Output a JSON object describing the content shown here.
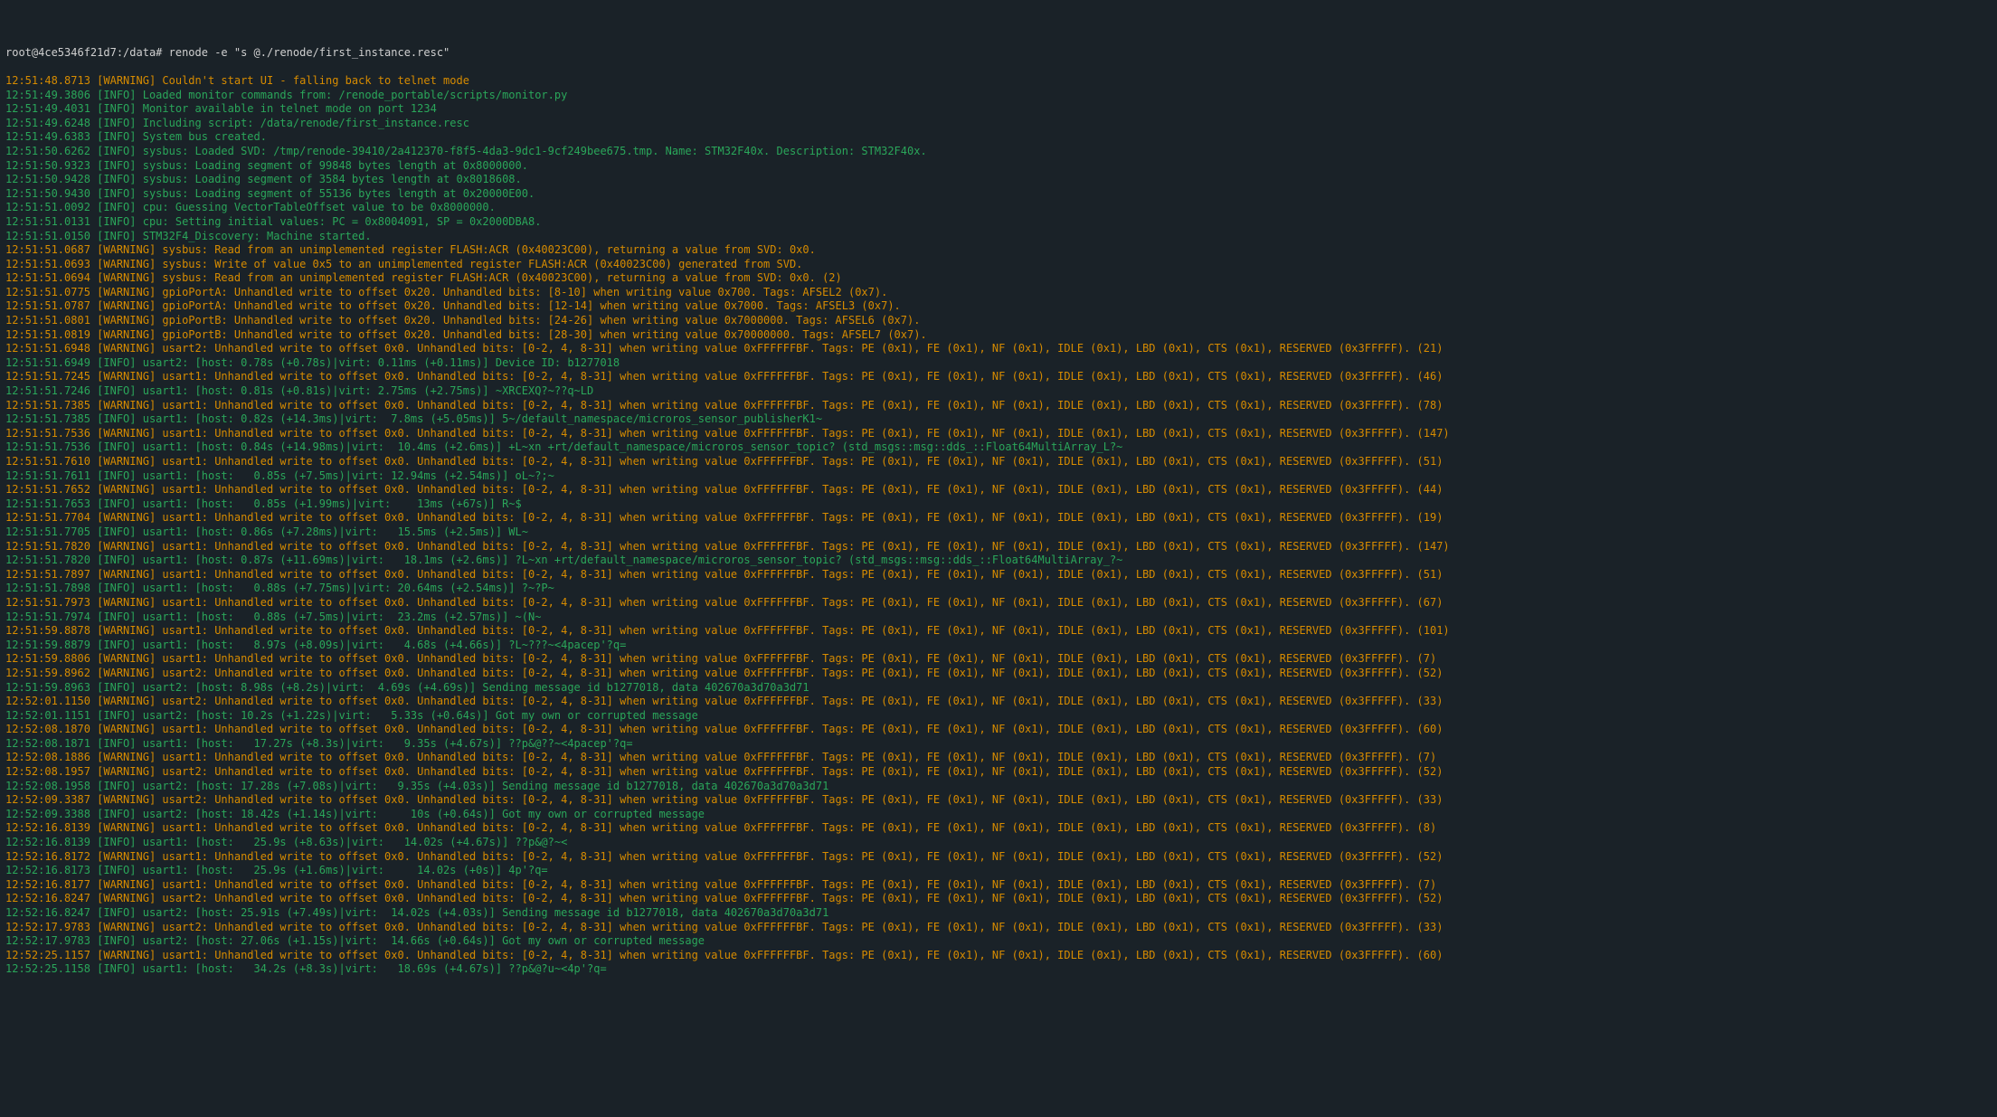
{
  "prompt": "root@4ce5346f21d7:/data# ",
  "command": "renode -e \"s @./renode/first_instance.resc\"",
  "lines": [
    {
      "t": "12:51:48.8713",
      "lvl": "WARNING",
      "msg": "Couldn't start UI - falling back to telnet mode"
    },
    {
      "t": "12:51:49.3806",
      "lvl": "INFO",
      "msg": "Loaded monitor commands from: /renode_portable/scripts/monitor.py"
    },
    {
      "t": "12:51:49.4031",
      "lvl": "INFO",
      "msg": "Monitor available in telnet mode on port 1234"
    },
    {
      "t": "12:51:49.6248",
      "lvl": "INFO",
      "msg": "Including script: /data/renode/first_instance.resc"
    },
    {
      "t": "12:51:49.6383",
      "lvl": "INFO",
      "msg": "System bus created."
    },
    {
      "t": "12:51:50.6262",
      "lvl": "INFO",
      "msg": "sysbus: Loaded SVD: /tmp/renode-39410/2a412370-f8f5-4da3-9dc1-9cf249bee675.tmp. Name: STM32F40x. Description: STM32F40x."
    },
    {
      "t": "12:51:50.9323",
      "lvl": "INFO",
      "msg": "sysbus: Loading segment of 99848 bytes length at 0x8000000."
    },
    {
      "t": "12:51:50.9428",
      "lvl": "INFO",
      "msg": "sysbus: Loading segment of 3584 bytes length at 0x8018608."
    },
    {
      "t": "12:51:50.9430",
      "lvl": "INFO",
      "msg": "sysbus: Loading segment of 55136 bytes length at 0x20000E00."
    },
    {
      "t": "12:51:51.0092",
      "lvl": "INFO",
      "msg": "cpu: Guessing VectorTableOffset value to be 0x8000000."
    },
    {
      "t": "12:51:51.0131",
      "lvl": "INFO",
      "msg": "cpu: Setting initial values: PC = 0x8004091, SP = 0x2000DBA8."
    },
    {
      "t": "12:51:51.0150",
      "lvl": "INFO",
      "msg": "STM32F4_Discovery: Machine started."
    },
    {
      "t": "12:51:51.0687",
      "lvl": "WARNING",
      "msg": "sysbus: Read from an unimplemented register FLASH:ACR (0x40023C00), returning a value from SVD: 0x0."
    },
    {
      "t": "12:51:51.0693",
      "lvl": "WARNING",
      "msg": "sysbus: Write of value 0x5 to an unimplemented register FLASH:ACR (0x40023C00) generated from SVD."
    },
    {
      "t": "12:51:51.0694",
      "lvl": "WARNING",
      "msg": "sysbus: Read from an unimplemented register FLASH:ACR (0x40023C00), returning a value from SVD: 0x0. (2)"
    },
    {
      "t": "12:51:51.0775",
      "lvl": "WARNING",
      "msg": "gpioPortA: Unhandled write to offset 0x20. Unhandled bits: [8-10] when writing value 0x700. Tags: AFSEL2 (0x7)."
    },
    {
      "t": "12:51:51.0787",
      "lvl": "WARNING",
      "msg": "gpioPortA: Unhandled write to offset 0x20. Unhandled bits: [12-14] when writing value 0x7000. Tags: AFSEL3 (0x7)."
    },
    {
      "t": "12:51:51.0801",
      "lvl": "WARNING",
      "msg": "gpioPortB: Unhandled write to offset 0x20. Unhandled bits: [24-26] when writing value 0x7000000. Tags: AFSEL6 (0x7)."
    },
    {
      "t": "12:51:51.0819",
      "lvl": "WARNING",
      "msg": "gpioPortB: Unhandled write to offset 0x20. Unhandled bits: [28-30] when writing value 0x70000000. Tags: AFSEL7 (0x7)."
    },
    {
      "t": "12:51:51.6948",
      "lvl": "WARNING",
      "msg": "usart2: Unhandled write to offset 0x0. Unhandled bits: [0-2, 4, 8-31] when writing value 0xFFFFFFBF. Tags: PE (0x1), FE (0x1), NF (0x1), IDLE (0x1), LBD (0x1), CTS (0x1), RESERVED (0x3FFFFF). (21)"
    },
    {
      "t": "12:51:51.6949",
      "lvl": "INFO",
      "msg": "usart2: [host: 0.78s (+0.78s)|virt: 0.11ms (+0.11ms)] Device ID: b1277018"
    },
    {
      "t": "12:51:51.7245",
      "lvl": "WARNING",
      "msg": "usart1: Unhandled write to offset 0x0. Unhandled bits: [0-2, 4, 8-31] when writing value 0xFFFFFFBF. Tags: PE (0x1), FE (0x1), NF (0x1), IDLE (0x1), LBD (0x1), CTS (0x1), RESERVED (0x3FFFFF). (46)"
    },
    {
      "t": "12:51:51.7246",
      "lvl": "INFO",
      "msg": "usart1: [host: 0.81s (+0.81s)|virt: 2.75ms (+2.75ms)] ~XRCEXQ?~??q~LD"
    },
    {
      "t": "12:51:51.7385",
      "lvl": "WARNING",
      "msg": "usart1: Unhandled write to offset 0x0. Unhandled bits: [0-2, 4, 8-31] when writing value 0xFFFFFFBF. Tags: PE (0x1), FE (0x1), NF (0x1), IDLE (0x1), LBD (0x1), CTS (0x1), RESERVED (0x3FFFFF). (78)"
    },
    {
      "t": "12:51:51.7385",
      "lvl": "INFO",
      "msg": "usart1: [host: 0.82s (+14.3ms)|virt:  7.8ms (+5.05ms)] 5~/default_namespace/microros_sensor_publisherK1~"
    },
    {
      "t": "12:51:51.7536",
      "lvl": "WARNING",
      "msg": "usart1: Unhandled write to offset 0x0. Unhandled bits: [0-2, 4, 8-31] when writing value 0xFFFFFFBF. Tags: PE (0x1), FE (0x1), NF (0x1), IDLE (0x1), LBD (0x1), CTS (0x1), RESERVED (0x3FFFFF). (147)"
    },
    {
      "t": "12:51:51.7536",
      "lvl": "INFO",
      "msg": "usart1: [host: 0.84s (+14.98ms)|virt:  10.4ms (+2.6ms)] +L~xn +rt/default_namespace/microros_sensor_topic? (std_msgs::msg::dds_::Float64MultiArray_L?~"
    },
    {
      "t": "12:51:51.7610",
      "lvl": "WARNING",
      "msg": "usart1: Unhandled write to offset 0x0. Unhandled bits: [0-2, 4, 8-31] when writing value 0xFFFFFFBF. Tags: PE (0x1), FE (0x1), NF (0x1), IDLE (0x1), LBD (0x1), CTS (0x1), RESERVED (0x3FFFFF). (51)"
    },
    {
      "t": "12:51:51.7611",
      "lvl": "INFO",
      "msg": "usart1: [host:   0.85s (+7.5ms)|virt: 12.94ms (+2.54ms)] oL~?;~"
    },
    {
      "t": "12:51:51.7652",
      "lvl": "WARNING",
      "msg": "usart1: Unhandled write to offset 0x0. Unhandled bits: [0-2, 4, 8-31] when writing value 0xFFFFFFBF. Tags: PE (0x1), FE (0x1), NF (0x1), IDLE (0x1), LBD (0x1), CTS (0x1), RESERVED (0x3FFFFF). (44)"
    },
    {
      "t": "12:51:51.7653",
      "lvl": "INFO",
      "msg": "usart1: [host:   0.85s (+1.99ms)|virt:    13ms (+67s)] R~$"
    },
    {
      "t": "12:51:51.7704",
      "lvl": "WARNING",
      "msg": "usart1: Unhandled write to offset 0x0. Unhandled bits: [0-2, 4, 8-31] when writing value 0xFFFFFFBF. Tags: PE (0x1), FE (0x1), NF (0x1), IDLE (0x1), LBD (0x1), CTS (0x1), RESERVED (0x3FFFFF). (19)"
    },
    {
      "t": "12:51:51.7705",
      "lvl": "INFO",
      "msg": "usart1: [host: 0.86s (+7.28ms)|virt:   15.5ms (+2.5ms)] WL~"
    },
    {
      "t": "12:51:51.7820",
      "lvl": "WARNING",
      "msg": "usart1: Unhandled write to offset 0x0. Unhandled bits: [0-2, 4, 8-31] when writing value 0xFFFFFFBF. Tags: PE (0x1), FE (0x1), NF (0x1), IDLE (0x1), LBD (0x1), CTS (0x1), RESERVED (0x3FFFFF). (147)"
    },
    {
      "t": "12:51:51.7820",
      "lvl": "INFO",
      "msg": "usart1: [host: 0.87s (+11.69ms)|virt:   18.1ms (+2.6ms)] ?L~xn +rt/default_namespace/microros_sensor_topic? (std_msgs::msg::dds_::Float64MultiArray_?~"
    },
    {
      "t": "12:51:51.7897",
      "lvl": "WARNING",
      "msg": "usart1: Unhandled write to offset 0x0. Unhandled bits: [0-2, 4, 8-31] when writing value 0xFFFFFFBF. Tags: PE (0x1), FE (0x1), NF (0x1), IDLE (0x1), LBD (0x1), CTS (0x1), RESERVED (0x3FFFFF). (51)"
    },
    {
      "t": "12:51:51.7898",
      "lvl": "INFO",
      "msg": "usart1: [host:   0.88s (+7.75ms)|virt: 20.64ms (+2.54ms)] ?~?P~"
    },
    {
      "t": "12:51:51.7973",
      "lvl": "WARNING",
      "msg": "usart1: Unhandled write to offset 0x0. Unhandled bits: [0-2, 4, 8-31] when writing value 0xFFFFFFBF. Tags: PE (0x1), FE (0x1), NF (0x1), IDLE (0x1), LBD (0x1), CTS (0x1), RESERVED (0x3FFFFF). (67)"
    },
    {
      "t": "12:51:51.7974",
      "lvl": "INFO",
      "msg": "usart1: [host:   0.88s (+7.5ms)|virt:  23.2ms (+2.57ms)] ~(N~"
    },
    {
      "t": "12:51:59.8878",
      "lvl": "WARNING",
      "msg": "usart1: Unhandled write to offset 0x0. Unhandled bits: [0-2, 4, 8-31] when writing value 0xFFFFFFBF. Tags: PE (0x1), FE (0x1), NF (0x1), IDLE (0x1), LBD (0x1), CTS (0x1), RESERVED (0x3FFFFF). (101)"
    },
    {
      "t": "12:51:59.8879",
      "lvl": "INFO",
      "msg": "usart1: [host:   8.97s (+8.09s)|virt:   4.68s (+4.66s)] ?L~???~<4pacep'?q="
    },
    {
      "t": "12:51:59.8806",
      "lvl": "WARNING",
      "msg": "usart1: Unhandled write to offset 0x0. Unhandled bits: [0-2, 4, 8-31] when writing value 0xFFFFFFBF. Tags: PE (0x1), FE (0x1), NF (0x1), IDLE (0x1), LBD (0x1), CTS (0x1), RESERVED (0x3FFFFF). (7)"
    },
    {
      "t": "12:51:59.8962",
      "lvl": "WARNING",
      "msg": "usart2: Unhandled write to offset 0x0. Unhandled bits: [0-2, 4, 8-31] when writing value 0xFFFFFFBF. Tags: PE (0x1), FE (0x1), NF (0x1), IDLE (0x1), LBD (0x1), CTS (0x1), RESERVED (0x3FFFFF). (52)"
    },
    {
      "t": "12:51:59.8963",
      "lvl": "INFO",
      "msg": "usart2: [host: 8.98s (+8.2s)|virt:  4.69s (+4.69s)] Sending message id b1277018, data 402670a3d70a3d71"
    },
    {
      "t": "12:52:01.1150",
      "lvl": "WARNING",
      "msg": "usart2: Unhandled write to offset 0x0. Unhandled bits: [0-2, 4, 8-31] when writing value 0xFFFFFFBF. Tags: PE (0x1), FE (0x1), NF (0x1), IDLE (0x1), LBD (0x1), CTS (0x1), RESERVED (0x3FFFFF). (33)"
    },
    {
      "t": "12:52:01.1151",
      "lvl": "INFO",
      "msg": "usart2: [host: 10.2s (+1.22s)|virt:   5.33s (+0.64s)] Got my own or corrupted message"
    },
    {
      "t": "12:52:08.1870",
      "lvl": "WARNING",
      "msg": "usart1: Unhandled write to offset 0x0. Unhandled bits: [0-2, 4, 8-31] when writing value 0xFFFFFFBF. Tags: PE (0x1), FE (0x1), NF (0x1), IDLE (0x1), LBD (0x1), CTS (0x1), RESERVED (0x3FFFFF). (60)"
    },
    {
      "t": "12:52:08.1871",
      "lvl": "INFO",
      "msg": "usart1: [host:   17.27s (+8.3s)|virt:   9.35s (+4.67s)] ??p&@??~<4pacep'?q="
    },
    {
      "t": "12:52:08.1886",
      "lvl": "WARNING",
      "msg": "usart1: Unhandled write to offset 0x0. Unhandled bits: [0-2, 4, 8-31] when writing value 0xFFFFFFBF. Tags: PE (0x1), FE (0x1), NF (0x1), IDLE (0x1), LBD (0x1), CTS (0x1), RESERVED (0x3FFFFF). (7)"
    },
    {
      "t": "12:52:08.1957",
      "lvl": "WARNING",
      "msg": "usart2: Unhandled write to offset 0x0. Unhandled bits: [0-2, 4, 8-31] when writing value 0xFFFFFFBF. Tags: PE (0x1), FE (0x1), NF (0x1), IDLE (0x1), LBD (0x1), CTS (0x1), RESERVED (0x3FFFFF). (52)"
    },
    {
      "t": "12:52:08.1958",
      "lvl": "INFO",
      "msg": "usart2: [host: 17.28s (+7.08s)|virt:   9.35s (+4.03s)] Sending message id b1277018, data 402670a3d70a3d71"
    },
    {
      "t": "12:52:09.3387",
      "lvl": "WARNING",
      "msg": "usart2: Unhandled write to offset 0x0. Unhandled bits: [0-2, 4, 8-31] when writing value 0xFFFFFFBF. Tags: PE (0x1), FE (0x1), NF (0x1), IDLE (0x1), LBD (0x1), CTS (0x1), RESERVED (0x3FFFFF). (33)"
    },
    {
      "t": "12:52:09.3388",
      "lvl": "INFO",
      "msg": "usart2: [host: 18.42s (+1.14s)|virt:     10s (+0.64s)] Got my own or corrupted message"
    },
    {
      "t": "12:52:16.8139",
      "lvl": "WARNING",
      "msg": "usart1: Unhandled write to offset 0x0. Unhandled bits: [0-2, 4, 8-31] when writing value 0xFFFFFFBF. Tags: PE (0x1), FE (0x1), NF (0x1), IDLE (0x1), LBD (0x1), CTS (0x1), RESERVED (0x3FFFFF). (8)"
    },
    {
      "t": "12:52:16.8139",
      "lvl": "INFO",
      "msg": "usart1: [host:   25.9s (+8.63s)|virt:   14.02s (+4.67s)] ??p&@?~<"
    },
    {
      "t": "12:52:16.8172",
      "lvl": "WARNING",
      "msg": "usart1: Unhandled write to offset 0x0. Unhandled bits: [0-2, 4, 8-31] when writing value 0xFFFFFFBF. Tags: PE (0x1), FE (0x1), NF (0x1), IDLE (0x1), LBD (0x1), CTS (0x1), RESERVED (0x3FFFFF). (52)"
    },
    {
      "t": "12:52:16.8173",
      "lvl": "INFO",
      "msg": "usart1: [host:   25.9s (+1.6ms)|virt:     14.02s (+0s)] 4p'?q="
    },
    {
      "t": "12:52:16.8177",
      "lvl": "WARNING",
      "msg": "usart1: Unhandled write to offset 0x0. Unhandled bits: [0-2, 4, 8-31] when writing value 0xFFFFFFBF. Tags: PE (0x1), FE (0x1), NF (0x1), IDLE (0x1), LBD (0x1), CTS (0x1), RESERVED (0x3FFFFF). (7)"
    },
    {
      "t": "12:52:16.8247",
      "lvl": "WARNING",
      "msg": "usart2: Unhandled write to offset 0x0. Unhandled bits: [0-2, 4, 8-31] when writing value 0xFFFFFFBF. Tags: PE (0x1), FE (0x1), NF (0x1), IDLE (0x1), LBD (0x1), CTS (0x1), RESERVED (0x3FFFFF). (52)"
    },
    {
      "t": "12:52:16.8247",
      "lvl": "INFO",
      "msg": "usart2: [host: 25.91s (+7.49s)|virt:  14.02s (+4.03s)] Sending message id b1277018, data 402670a3d70a3d71"
    },
    {
      "t": "12:52:17.9783",
      "lvl": "WARNING",
      "msg": "usart2: Unhandled write to offset 0x0. Unhandled bits: [0-2, 4, 8-31] when writing value 0xFFFFFFBF. Tags: PE (0x1), FE (0x1), NF (0x1), IDLE (0x1), LBD (0x1), CTS (0x1), RESERVED (0x3FFFFF). (33)"
    },
    {
      "t": "12:52:17.9783",
      "lvl": "INFO",
      "msg": "usart2: [host: 27.06s (+1.15s)|virt:  14.66s (+0.64s)] Got my own or corrupted message"
    },
    {
      "t": "12:52:25.1157",
      "lvl": "WARNING",
      "msg": "usart1: Unhandled write to offset 0x0. Unhandled bits: [0-2, 4, 8-31] when writing value 0xFFFFFFBF. Tags: PE (0x1), FE (0x1), NF (0x1), IDLE (0x1), LBD (0x1), CTS (0x1), RESERVED (0x3FFFFF). (60)"
    },
    {
      "t": "12:52:25.1158",
      "lvl": "INFO",
      "msg": "usart1: [host:   34.2s (+8.3s)|virt:   18.69s (+4.67s)] ??p&@?u~<4p'?q="
    }
  ]
}
